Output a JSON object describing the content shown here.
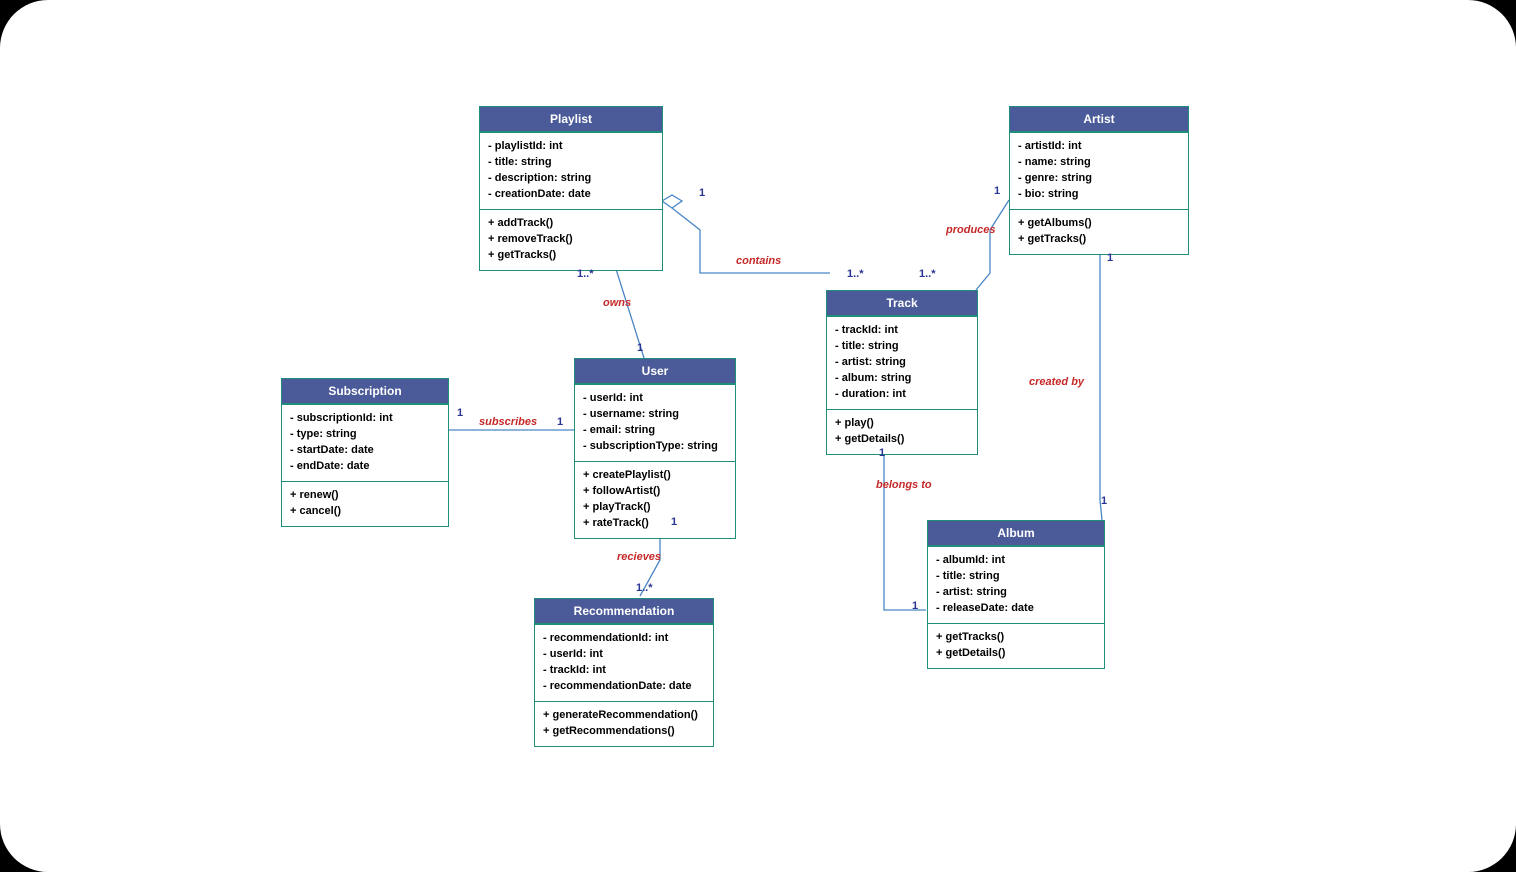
{
  "classes": {
    "playlist": {
      "title": "Playlist",
      "attrs": [
        "- playlistId: int",
        "- title: string",
        "- description: string",
        "- creationDate: date"
      ],
      "ops": [
        "+ addTrack()",
        "+ removeTrack()",
        "+ getTracks()"
      ]
    },
    "artist": {
      "title": "Artist",
      "attrs": [
        "- artistId: int",
        "- name: string",
        "- genre: string",
        "- bio: string"
      ],
      "ops": [
        "+ getAlbums()",
        "+ getTracks()"
      ]
    },
    "subscription": {
      "title": "Subscription",
      "attrs": [
        "- subscriptionId: int",
        "- type: string",
        "- startDate: date",
        "- endDate: date"
      ],
      "ops": [
        "+ renew()",
        "+ cancel()"
      ]
    },
    "user": {
      "title": "User",
      "attrs": [
        "- userId: int",
        "- username: string",
        "- email: string",
        "- subscriptionType: string"
      ],
      "ops": [
        "+ createPlaylist()",
        "+ followArtist()",
        "+ playTrack()",
        "+ rateTrack()"
      ]
    },
    "track": {
      "title": "Track",
      "attrs": [
        "- trackId: int",
        "- title: string",
        "- artist: string",
        "- album: string",
        "- duration: int"
      ],
      "ops": [
        "+ play()",
        "+ getDetails()"
      ]
    },
    "recommendation": {
      "title": "Recommendation",
      "attrs": [
        "- recommendationId: int",
        "- userId: int",
        "- trackId: int",
        "- recommendationDate: date"
      ],
      "ops": [
        "+ generateRecommendation()",
        "+ getRecommendations()"
      ]
    },
    "album": {
      "title": "Album",
      "attrs": [
        "- albumId: int",
        "- title: string",
        "- artist: string",
        "- releaseDate: date"
      ],
      "ops": [
        "+ getTracks()",
        "+ getDetails()"
      ]
    }
  },
  "relationships": {
    "owns": {
      "label": "owns",
      "from": "User",
      "to": "Playlist",
      "from_mult": "1",
      "to_mult": "1..*"
    },
    "subscribes": {
      "label": "subscribes",
      "from": "User",
      "to": "Subscription",
      "from_mult": "1",
      "to_mult": "1"
    },
    "recieves": {
      "label": "recieves",
      "from": "User",
      "to": "Recommendation",
      "from_mult": "1",
      "to_mult": "1..*"
    },
    "contains": {
      "label": "contains",
      "from": "Playlist",
      "to": "Track",
      "from_mult": "1",
      "to_mult": "1..*"
    },
    "produces": {
      "label": "produces",
      "from": "Artist",
      "to": "Track",
      "from_mult": "1",
      "to_mult": "1..*"
    },
    "created_by": {
      "label": "created by",
      "from": "Album",
      "to": "Artist",
      "from_mult": "1",
      "to_mult": "1"
    },
    "belongs_to": {
      "label": "belongs to",
      "from": "Track",
      "to": "Album",
      "from_mult": "1",
      "to_mult": "1"
    }
  },
  "chart_data": {
    "type": "uml-class-diagram",
    "classes": [
      {
        "name": "Playlist",
        "attributes": [
          "playlistId:int",
          "title:string",
          "description:string",
          "creationDate:date"
        ],
        "operations": [
          "addTrack()",
          "removeTrack()",
          "getTracks()"
        ]
      },
      {
        "name": "Artist",
        "attributes": [
          "artistId:int",
          "name:string",
          "genre:string",
          "bio:string"
        ],
        "operations": [
          "getAlbums()",
          "getTracks()"
        ]
      },
      {
        "name": "Subscription",
        "attributes": [
          "subscriptionId:int",
          "type:string",
          "startDate:date",
          "endDate:date"
        ],
        "operations": [
          "renew()",
          "cancel()"
        ]
      },
      {
        "name": "User",
        "attributes": [
          "userId:int",
          "username:string",
          "email:string",
          "subscriptionType:string"
        ],
        "operations": [
          "createPlaylist()",
          "followArtist()",
          "playTrack()",
          "rateTrack()"
        ]
      },
      {
        "name": "Track",
        "attributes": [
          "trackId:int",
          "title:string",
          "artist:string",
          "album:string",
          "duration:int"
        ],
        "operations": [
          "play()",
          "getDetails()"
        ]
      },
      {
        "name": "Recommendation",
        "attributes": [
          "recommendationId:int",
          "userId:int",
          "trackId:int",
          "recommendationDate:date"
        ],
        "operations": [
          "generateRecommendation()",
          "getRecommendations()"
        ]
      },
      {
        "name": "Album",
        "attributes": [
          "albumId:int",
          "title:string",
          "artist:string",
          "releaseDate:date"
        ],
        "operations": [
          "getTracks()",
          "getDetails()"
        ]
      }
    ],
    "associations": [
      {
        "name": "owns",
        "ends": [
          {
            "class": "User",
            "mult": "1"
          },
          {
            "class": "Playlist",
            "mult": "1..*"
          }
        ]
      },
      {
        "name": "subscribes",
        "ends": [
          {
            "class": "User",
            "mult": "1"
          },
          {
            "class": "Subscription",
            "mult": "1"
          }
        ]
      },
      {
        "name": "recieves",
        "ends": [
          {
            "class": "User",
            "mult": "1"
          },
          {
            "class": "Recommendation",
            "mult": "1..*"
          }
        ]
      },
      {
        "name": "contains",
        "type": "aggregation",
        "whole": "Playlist",
        "ends": [
          {
            "class": "Playlist",
            "mult": "1"
          },
          {
            "class": "Track",
            "mult": "1..*"
          }
        ]
      },
      {
        "name": "produces",
        "ends": [
          {
            "class": "Artist",
            "mult": "1"
          },
          {
            "class": "Track",
            "mult": "1..*"
          }
        ]
      },
      {
        "name": "created by",
        "ends": [
          {
            "class": "Album",
            "mult": "1"
          },
          {
            "class": "Artist",
            "mult": "1"
          }
        ]
      },
      {
        "name": "belongs to",
        "ends": [
          {
            "class": "Track",
            "mult": "1"
          },
          {
            "class": "Album",
            "mult": "1"
          }
        ]
      }
    ]
  }
}
